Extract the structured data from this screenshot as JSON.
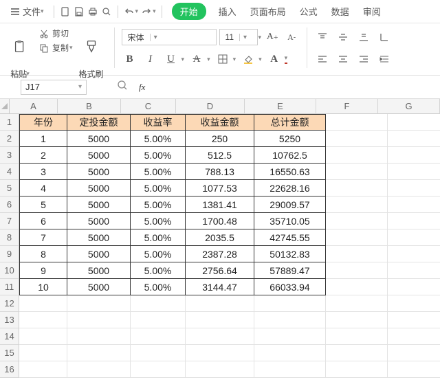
{
  "menubar": {
    "file": "文件",
    "start": "开始",
    "tabs": [
      "插入",
      "页面布局",
      "公式",
      "数据",
      "审阅"
    ]
  },
  "ribbon": {
    "paste": "粘贴",
    "cut": "剪切",
    "copy": "复制",
    "format_painter": "格式刷",
    "font_name": "宋体",
    "font_size": "11",
    "bold": "B",
    "italic": "I",
    "underline": "U",
    "strike": "A"
  },
  "formula_bar": {
    "cell_ref": "J17",
    "fx_label": "fx",
    "formula": ""
  },
  "columns": [
    "A",
    "B",
    "C",
    "D",
    "E",
    "F",
    "G"
  ],
  "row_count": 16,
  "tableStartRow": 1,
  "headers": [
    "年份",
    "定投金额",
    "收益率",
    "收益金额",
    "总计金额"
  ],
  "rows": [
    [
      "1",
      "5000",
      "5.00%",
      "250",
      "5250"
    ],
    [
      "2",
      "5000",
      "5.00%",
      "512.5",
      "10762.5"
    ],
    [
      "3",
      "5000",
      "5.00%",
      "788.13",
      "16550.63"
    ],
    [
      "4",
      "5000",
      "5.00%",
      "1077.53",
      "22628.16"
    ],
    [
      "5",
      "5000",
      "5.00%",
      "1381.41",
      "29009.57"
    ],
    [
      "6",
      "5000",
      "5.00%",
      "1700.48",
      "35710.05"
    ],
    [
      "7",
      "5000",
      "5.00%",
      "2035.5",
      "42745.55"
    ],
    [
      "8",
      "5000",
      "5.00%",
      "2387.28",
      "50132.83"
    ],
    [
      "9",
      "5000",
      "5.00%",
      "2756.64",
      "57889.47"
    ],
    [
      "10",
      "5000",
      "5.00%",
      "3144.47",
      "66033.94"
    ]
  ],
  "colWidths": [
    "cA",
    "cB",
    "cC",
    "cD",
    "cE",
    "cF",
    "cG"
  ]
}
